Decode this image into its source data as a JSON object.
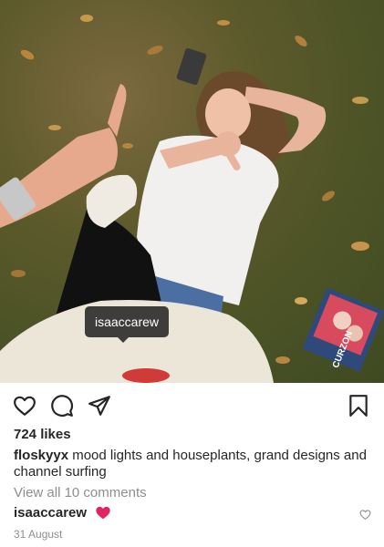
{
  "post": {
    "photo_tag_username": "isaaccarew",
    "book_cover_text": "CURZON",
    "likes": "724 likes",
    "caption_username": "floskyyx",
    "caption_text": " mood lights and houseplants, grand designs and channel surfing",
    "view_comments": "View all 10 comments",
    "comment_username": "isaaccarew",
    "comment_emoji": "red-heart",
    "date": "31 August"
  },
  "icons": {
    "like": "heart-outline-icon",
    "comment": "speech-bubble-icon",
    "share": "paper-plane-icon",
    "save": "bookmark-icon",
    "comment_like": "small-heart-outline-icon"
  },
  "colors": {
    "text": "#262626",
    "secondary_text": "#8e8e8e",
    "heart_red": "#e0245e",
    "tag_bubble": "#262626"
  }
}
